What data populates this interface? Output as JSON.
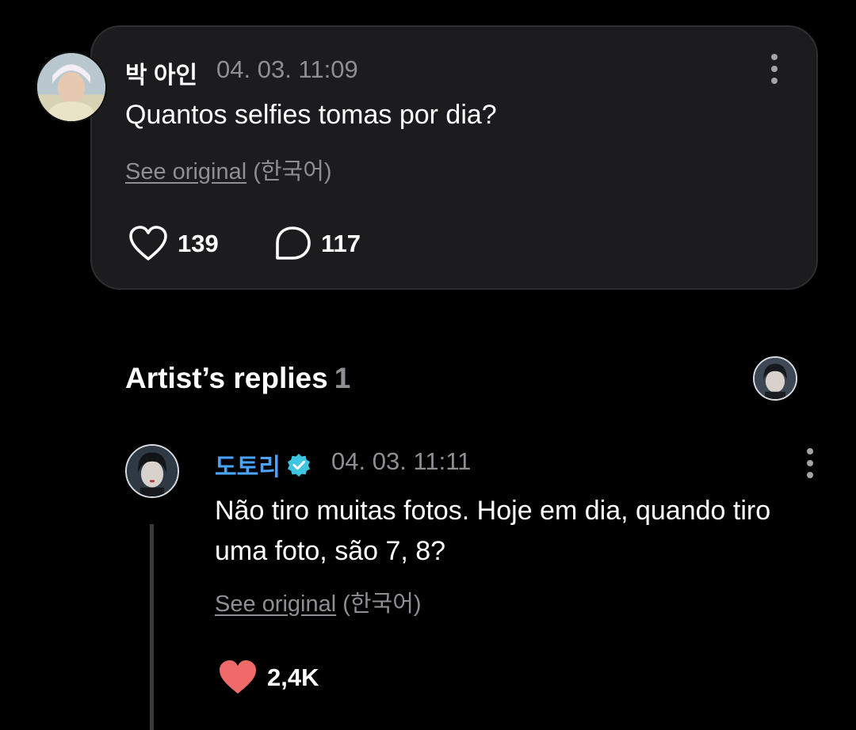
{
  "post": {
    "author": "박 아인",
    "time": "04. 03. 11:09",
    "text": "Quantos selfies tomas por dia?",
    "see_original_label": "See original",
    "language_label": "(한국어)",
    "likes": "139",
    "comments": "117",
    "like_icon": "heart-outline-icon",
    "comment_icon": "speech-bubble-icon"
  },
  "replies": {
    "header_label": "Artist’s replies",
    "header_count": "1"
  },
  "reply": {
    "author": "도토리",
    "verified_icon": "verified-badge-icon",
    "time": "04. 03. 11:11",
    "text": "Não tiro muitas fotos. Hoje em dia, quando tiro uma foto, são 7, 8?",
    "see_original_label": "See original",
    "language_label": "(한국어)",
    "likes": "2,4K",
    "like_icon": "heart-filled-icon"
  },
  "colors": {
    "background": "#000000",
    "card": "#1c1c1e",
    "artist_name": "#4aa3ff",
    "liked_heart": "#f06a6a",
    "muted_text": "#8e8e93"
  }
}
